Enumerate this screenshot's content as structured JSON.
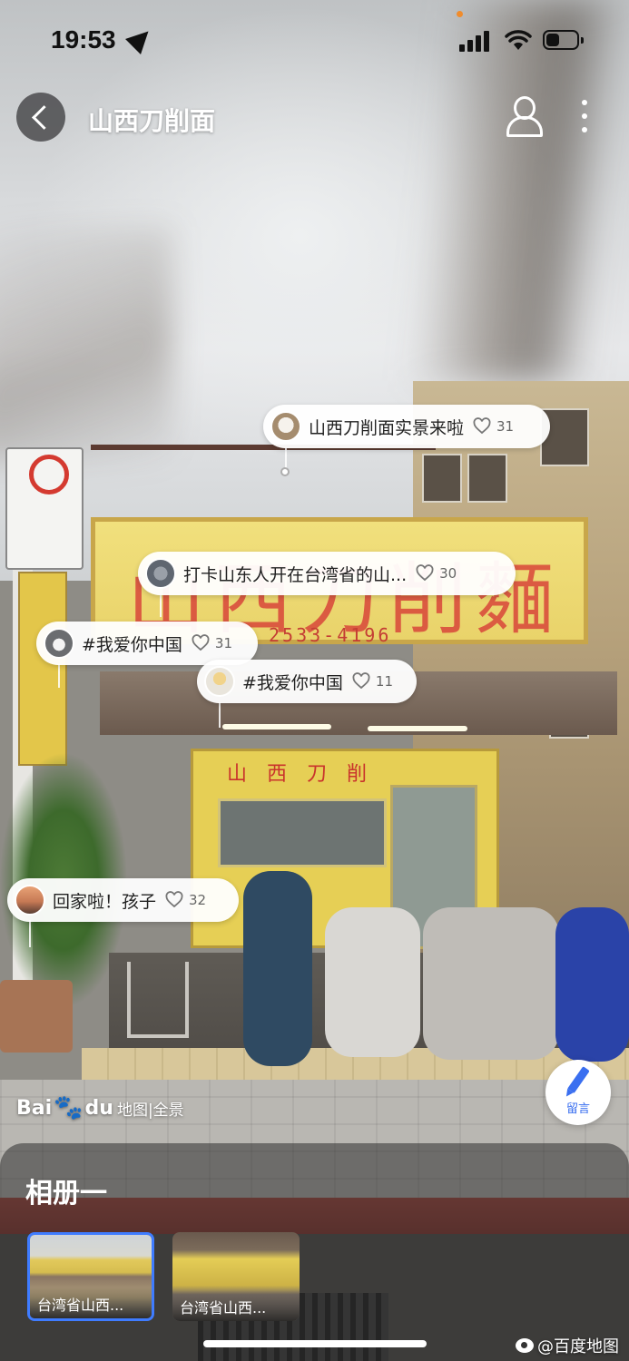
{
  "status_bar": {
    "time": "19:53",
    "battery_level": 0.45
  },
  "nav": {
    "title": "山西刀削面"
  },
  "scene": {
    "sign_main": "山西刀削麵",
    "sign_phone": "2533-4196",
    "store_banner": "山西刀削"
  },
  "comments": [
    {
      "text": "山西刀削面实景来啦",
      "likes": "31"
    },
    {
      "text": "打卡山东人开在台湾省的山...",
      "likes": "30"
    },
    {
      "text": "#我爱你中国",
      "likes": "31"
    },
    {
      "text": "#我爱你中国",
      "likes": "11"
    },
    {
      "text": "回家啦！孩子",
      "likes": "32"
    }
  ],
  "watermark": {
    "brand": "Bai",
    "brand_tail": "du",
    "product": "地图|全景"
  },
  "fab": {
    "label": "留言",
    "icon": "pen-icon"
  },
  "album": {
    "title": "相册一",
    "thumbnails": [
      {
        "caption": "台湾省山西...",
        "selected": true
      },
      {
        "caption": "台湾省山西...",
        "selected": false
      }
    ]
  },
  "footer": {
    "weibo_credit": "@百度地图"
  },
  "colors": {
    "accent_blue": "#3f7cff",
    "fab_blue": "#3a6ff0",
    "sign_yellow": "#e9d36a",
    "sign_red": "#d9463a"
  }
}
